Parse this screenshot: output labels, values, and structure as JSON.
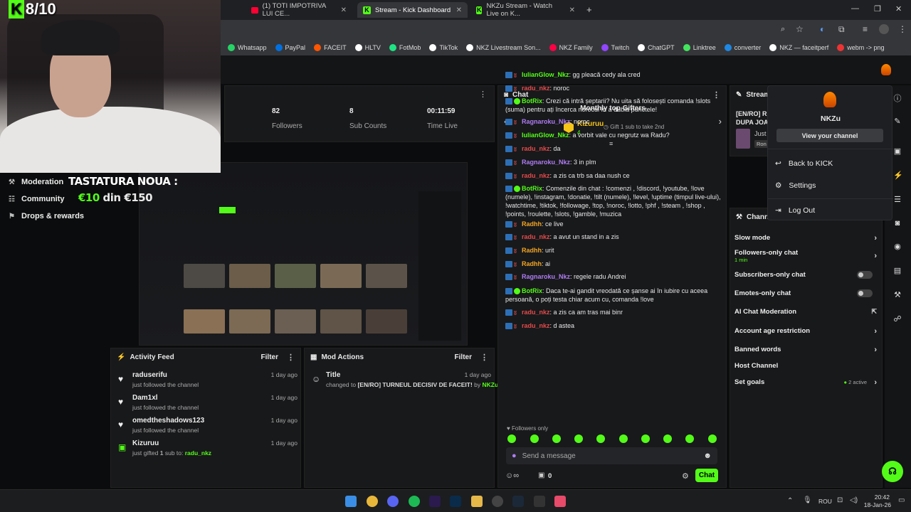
{
  "overlay": {
    "score": "8/10",
    "score_k": "K",
    "line1": "TASTATURA NOUA :",
    "line2_amount": "€10",
    "line2_rest": " din €150"
  },
  "tabs": [
    {
      "label": "(1) TOTI IMPOTRIVA LUI CE..."
    },
    {
      "label": "Stream - Kick Dashboard"
    },
    {
      "label": "NKZu Stream - Watch Live on K..."
    }
  ],
  "bookmarks": [
    "Whatsapp",
    "PayPal",
    "FACEIT",
    "HLTV",
    "FotMob",
    "TikTok",
    "NKZ Livestream Son...",
    "NKZ Family",
    "Twitch",
    "ChatGPT",
    "Linktree",
    "converter",
    "NKZ — faceitperf",
    "webm -> png"
  ],
  "left_nav": [
    {
      "label": "Moderation",
      "icon": "hammer-icon"
    },
    {
      "label": "Community",
      "icon": "users-icon"
    },
    {
      "label": "Drops & rewards",
      "icon": "gift-icon"
    }
  ],
  "stats": [
    {
      "value": "82",
      "label": "Followers"
    },
    {
      "value": "8",
      "label": "Sub Counts"
    },
    {
      "value": "00:11:59",
      "label": "Time Live"
    }
  ],
  "activity": {
    "title": "Activity Feed",
    "filter": "Filter",
    "items": [
      {
        "name": "raduserifu",
        "desc": "just followed the channel",
        "time": "1 day ago"
      },
      {
        "name": "Dam1xl",
        "desc": "just followed the channel",
        "time": "1 day ago"
      },
      {
        "name": "omedtheshadows123",
        "desc": "just followed the channel",
        "time": "1 day ago"
      },
      {
        "name": "Kizuruu",
        "desc_pre": "just gifted ",
        "desc_n": "1",
        "desc_mid": " sub to: ",
        "desc_user": "radu_nkz",
        "time": "1 day ago"
      }
    ]
  },
  "modactions": {
    "title": "Mod Actions",
    "filter": "Filter",
    "item_title": "Title",
    "time": "1 day ago",
    "changed_to": "changed to ",
    "new_title": "[EN/RO] TURNEUL DECISIV DE FACEIT!",
    "by": " by ",
    "by_user": "NKZu"
  },
  "chat": {
    "title": "Chat",
    "gifters_title": "Monthly top Gifters",
    "top_gifter": "Kizuruu",
    "top_gifter_count": "4",
    "gift_hint": "Gift 1 sub to take 2nd",
    "messages": [
      {
        "user": "IulianGlow_Nkz",
        "color": "green",
        "text": ": gg pleacă cedy ala cred"
      },
      {
        "user": "radu_nkz",
        "color": "red",
        "text": ": noroc"
      },
      {
        "user": "BotRix",
        "color": "green",
        "text": ": Crezi că intră șeptarii? Nu uita să folosești comanda !slots (suma) pentru ați încerca norocul în a dubla punctele!"
      },
      {
        "user": "Ragnaroku_Nkz",
        "color": "purple",
        "text": ": noroc"
      },
      {
        "user": "IulianGlow_Nkz",
        "color": "green",
        "text": ": a vorbit vale cu negrutz wa Radu?"
      },
      {
        "user": "radu_nkz",
        "color": "red",
        "text": ": da"
      },
      {
        "user": "Ragnaroku_Nkz",
        "color": "purple",
        "text": ": 3 in plm"
      },
      {
        "user": "radu_nkz",
        "color": "red",
        "text": ": a zis ca trb sa daa nush ce"
      },
      {
        "user": "BotRix",
        "color": "green",
        "text": ": Comenzile din chat : !comenzi , !discord, !youtube, !love (numele), !instagram, !donatie, !tilt (numele), !level, !uptime (timpul live-ului), !watchtime, !tiktok, !followage, !top, !noroc, !lotto, !phf , !steam , !shop , !points, !roulette, !slots, !gamble, !muzica"
      },
      {
        "user": "Radhh",
        "color": "orange",
        "text": ": ce live"
      },
      {
        "user": "radu_nkz",
        "color": "red",
        "text": ": a avut un stand in a zis"
      },
      {
        "user": "Radhh",
        "color": "orange",
        "text": ": urit"
      },
      {
        "user": "Radhh",
        "color": "orange",
        "text": ": ai"
      },
      {
        "user": "Ragnaroku_Nkz",
        "color": "purple",
        "text": ": regele radu Andrei"
      },
      {
        "user": "BotRix",
        "color": "green",
        "text": ": Daca te-ai gandit vreodată ce șanse ai în iubire cu aceea persoană, o poți testa chiar acum cu, comanda !love"
      },
      {
        "user": "radu_nkz",
        "color": "red",
        "text": ": a zis ca am tras mai binr"
      },
      {
        "user": "radu_nkz",
        "color": "red",
        "text": ": d astea"
      }
    ],
    "followers_only": "Followers only",
    "placeholder": "Send a message",
    "count": "0",
    "send": "Chat"
  },
  "stream_info": {
    "title": "Stream i",
    "stream_title": "[EN/RO] RI",
    "stream_title2": "DUPA JOA",
    "just": "Just",
    "tag": "Ron"
  },
  "dropdown": {
    "name": "NKZu",
    "view": "View your channel",
    "back": "Back to KICK",
    "settings": "Settings",
    "logout": "Log Out"
  },
  "channel": {
    "title": "Channel",
    "rows": [
      {
        "label": "Slow mode"
      },
      {
        "label": "Followers-only chat",
        "sub": "1 min"
      },
      {
        "label": "Subscribers-only chat"
      },
      {
        "label": "Emotes-only chat"
      },
      {
        "label": "AI Chat Moderation"
      },
      {
        "label": "Account age restriction"
      },
      {
        "label": "Banned words"
      },
      {
        "label": "Host Channel"
      },
      {
        "label": "Set goals",
        "badge": "2 active"
      }
    ]
  },
  "taskbar": {
    "lang": "ROU",
    "time": "20:42",
    "date": "18-Jan-26"
  },
  "colors": {
    "accent": "#53fc18",
    "bg": "#0b0c0d",
    "panel": "#18191b"
  }
}
